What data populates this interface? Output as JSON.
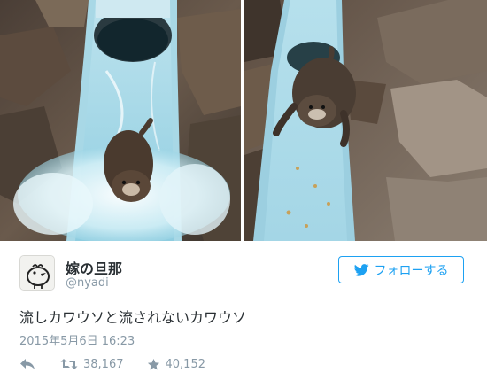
{
  "media": {
    "left_photo_alt": "otter sliding down water slide",
    "right_photo_alt": "otter holding on to slide"
  },
  "tweet": {
    "display_name": "嫁の旦那",
    "handle": "@nyadi",
    "follow_label": "フォローする",
    "text": "流しカワウソと流されないカワウソ",
    "timestamp": "2015年5月6日 16:23",
    "retweets": "38,167",
    "likes": "40,152"
  },
  "icons": {
    "avatar": "bird-avatar-icon",
    "follow": "twitter-bird-icon",
    "reply": "reply-icon",
    "retweet": "retweet-icon",
    "like": "star-icon"
  },
  "colors": {
    "accent": "#1da1f2",
    "text": "#292f33",
    "muted": "#8899a6",
    "slide": "#a9dcea",
    "water": "#d9f1f7"
  }
}
